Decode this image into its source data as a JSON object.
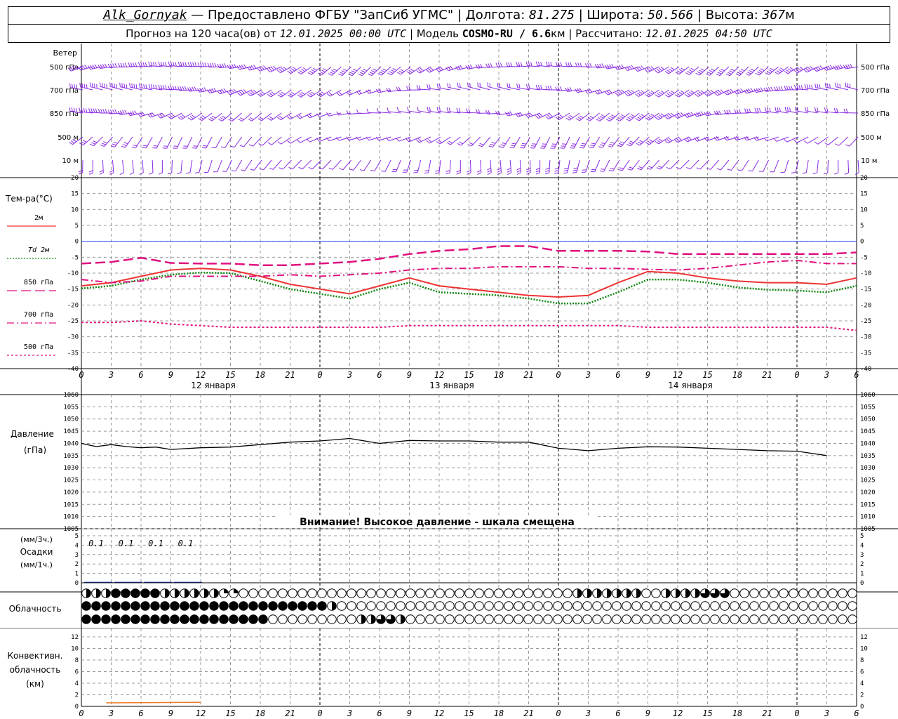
{
  "header": {
    "station": "Alk_Gornyak",
    "provider_text": " — Предоставлено ФГБУ \"ЗапСиб УГМС\" | Долгота: ",
    "longitude": "81.275",
    "lat_label": " | Широта: ",
    "latitude": "50.566",
    "alt_label": " | Высота: ",
    "altitude": "367",
    "alt_unit": "м",
    "forecast_label": "Прогноз на 120 часа(ов)  от ",
    "forecast_start": "12.01.2025 00:00 UTC",
    "model_label": "  | Модель ",
    "model_name": "COSMO-RU / 6.6",
    "model_unit": "км",
    "calc_label": " | Рассчитано: ",
    "calc_time": "12.01.2025 04:50 UTC"
  },
  "colors": {
    "wind": "#8a2be2",
    "t2m": "#ee3333",
    "td2m": "#118811",
    "t850": "#e0117f",
    "t700": "#e0117f",
    "t500": "#e0117f",
    "pressure": "#000000",
    "precip": "#1e3cc8",
    "convective": "#f07820",
    "zero_line": "#3050ff",
    "grid": "#999999"
  },
  "time_axis": {
    "tick_labels": [
      "0",
      "3",
      "6",
      "9",
      "12",
      "15",
      "18",
      "21",
      "0",
      "3",
      "6",
      "9",
      "12",
      "15",
      "18",
      "21",
      "0",
      "3",
      "6",
      "9",
      "12",
      "15",
      "18",
      "21",
      "0",
      "3",
      "6"
    ],
    "day_labels": [
      "12 января",
      "13 января",
      "14 января"
    ]
  },
  "wind_panel": {
    "title": "Ветер",
    "levels": [
      "500 гПа",
      "700 гПа",
      "850 гПа",
      "500 м",
      "10  м"
    ]
  },
  "temperature_panel": {
    "title": "Тем-ра(°С)",
    "legend": [
      {
        "label": "2м",
        "style": "solid"
      },
      {
        "label": "Td  2м",
        "style": "dotted"
      },
      {
        "label": "850 гПа",
        "style": "dash"
      },
      {
        "label": "700 гПа",
        "style": "dashdot"
      },
      {
        "label": "500 гПа",
        "style": "dot"
      }
    ],
    "ticks": [
      "20",
      "15",
      "10",
      "5",
      "0",
      "-5",
      "-10",
      "-15",
      "-20",
      "-25",
      "-30",
      "-35",
      "-40"
    ]
  },
  "pressure_panel": {
    "title_line1": "Давление",
    "title_line2": "(гПа)",
    "warning": "Внимание! Высокое давление - шкала смещена",
    "ticks": [
      "1060",
      "1055",
      "1050",
      "1045",
      "1040",
      "1035",
      "1030",
      "1025",
      "1020",
      "1015",
      "1010",
      "1005"
    ]
  },
  "precip_panel": {
    "label1": "(мм/3ч.)",
    "label2": "Осадки",
    "label3": "(мм/1ч.)",
    "ticks": [
      "5",
      "4",
      "3",
      "2",
      "1",
      "0"
    ],
    "amounts": [
      "0.1",
      "0.1",
      "0.1",
      "0.1"
    ]
  },
  "cloud_panel": {
    "title": "Облачность"
  },
  "convective_panel": {
    "title_line1": "Конвективн.",
    "title_line2": "облачность",
    "title_line3": "(км)",
    "ticks": [
      "12",
      "10",
      "8",
      "6",
      "4",
      "2",
      "0"
    ]
  },
  "chart_data": [
    {
      "type": "barbs",
      "title": "Ветер",
      "levels": [
        "500 гПа",
        "700 гПа",
        "850 гПа",
        "500 м",
        "10  м"
      ],
      "note": "wind barbs every hour at five levels"
    },
    {
      "type": "line",
      "title": "Тем-ра(°С)",
      "x": [
        0,
        3,
        6,
        9,
        12,
        15,
        18,
        21,
        24,
        27,
        30,
        33,
        36,
        39,
        42,
        45,
        48,
        51,
        54,
        57,
        60,
        63,
        66,
        69,
        72,
        75,
        78
      ],
      "ylim": [
        -40,
        20
      ],
      "series": [
        {
          "name": "2м",
          "values": [
            -14,
            -13,
            -11,
            -9,
            -8.5,
            -9,
            -11,
            -13.5,
            -15,
            -16.5,
            -14,
            -11.5,
            -14,
            -15,
            -16,
            -17,
            -17.5,
            -17,
            -13,
            -9.5,
            -10,
            -11.5,
            -12.5,
            -13,
            -13,
            -13.5,
            -11.5
          ]
        },
        {
          "name": "Td  2м",
          "values": [
            -14.8,
            -14,
            -12,
            -10.5,
            -9.8,
            -10,
            -12.5,
            -15,
            -16.5,
            -18,
            -15,
            -13,
            -16,
            -16.5,
            -17,
            -18,
            -19.5,
            -19.5,
            -16,
            -12,
            -12,
            -13,
            -14.5,
            -15.2,
            -15.5,
            -16,
            -14
          ]
        },
        {
          "name": "850 гПа",
          "values": [
            -7,
            -6.5,
            -5.2,
            -6.8,
            -7,
            -7,
            -7.5,
            -7.5,
            -7,
            -6.5,
            -5.5,
            -4,
            -3,
            -2.5,
            -1.5,
            -1.5,
            -3,
            -3,
            -3,
            -3.2,
            -4,
            -4,
            -4,
            -4,
            -4,
            -4,
            -3.5
          ]
        },
        {
          "name": "700 гПа",
          "values": [
            -12,
            -13,
            -12.5,
            -11,
            -11,
            -11,
            -11,
            -10.5,
            -11,
            -10.5,
            -10,
            -9,
            -8.5,
            -8.5,
            -8,
            -8,
            -8,
            -8.5,
            -8.5,
            -8.8,
            -9,
            -8.5,
            -7.5,
            -6.5,
            -6,
            -7,
            -7
          ]
        },
        {
          "name": "500 гПа",
          "values": [
            -25.5,
            -25.5,
            -25,
            -26,
            -26.5,
            -27,
            -27,
            -27,
            -27,
            -27,
            -27,
            -26.5,
            -26.5,
            -26.5,
            -26.5,
            -26.5,
            -26.5,
            -26.5,
            -26.5,
            -27,
            -27,
            -27,
            -27,
            -27,
            -27,
            -27,
            -28
          ]
        }
      ]
    },
    {
      "type": "line",
      "title": "Давление (гПа)",
      "x": [
        0,
        1.5,
        3,
        4.5,
        6,
        7.5,
        9,
        12,
        15,
        18,
        21,
        24,
        27,
        30,
        33,
        36,
        39,
        42,
        45,
        48,
        51,
        54,
        57,
        60,
        63,
        66,
        69,
        72,
        75,
        78
      ],
      "ylim": [
        1005,
        1060
      ],
      "series": [
        {
          "name": "Давление",
          "values": [
            1040,
            1038.7,
            1039.5,
            1038.7,
            1038.2,
            1038.5,
            1037.5,
            1038.2,
            1038.5,
            1039.5,
            1040.5,
            1041,
            1042,
            1040,
            1041.2,
            1041,
            1041,
            1040.5,
            1040.5,
            1038,
            1037,
            1038,
            1038.6,
            1038.5,
            1038,
            1037.5,
            1037,
            1036.8,
            1035
          ]
        }
      ]
    },
    {
      "type": "bar",
      "title": "Осадки",
      "x": [
        0,
        3,
        6,
        9
      ],
      "values": [
        0.1,
        0.1,
        0.1,
        0.1
      ],
      "ylim": [
        0,
        5
      ]
    },
    {
      "type": "table",
      "title": "Облачность",
      "rows": [
        "upper",
        "middle",
        "lower"
      ],
      "values_per_hour": {
        "upper": [
          0.5,
          0.5,
          0.5,
          1,
          1,
          1,
          1,
          1,
          0.5,
          0.5,
          0.5,
          0.5,
          0.5,
          0.5,
          0.25,
          0.25,
          0,
          0,
          0,
          0,
          0,
          0,
          0,
          0,
          0,
          0,
          0,
          0,
          0,
          0,
          0,
          0,
          0,
          0,
          0,
          0,
          0,
          0,
          0,
          0,
          0,
          0,
          0,
          0,
          0,
          0,
          0,
          0,
          0,
          0,
          0.5,
          0.5,
          0.5,
          0.5,
          0.5,
          0.5,
          0.5,
          0,
          0,
          0.5,
          0.5,
          0.5,
          0.5,
          0.75,
          0.75,
          0.75,
          0,
          0,
          0,
          0,
          0,
          0,
          0,
          0,
          0,
          0,
          0,
          0,
          0
        ],
        "middle": [
          1,
          1,
          1,
          1,
          1,
          1,
          1,
          1,
          1,
          1,
          1,
          1,
          1,
          1,
          1,
          1,
          1,
          1,
          1,
          1,
          1,
          1,
          1,
          1,
          1,
          0.5,
          0,
          0,
          0,
          0,
          0,
          0,
          0,
          0,
          0,
          0,
          0,
          0,
          0,
          0,
          0,
          0,
          0,
          0,
          0,
          0,
          0,
          0,
          0,
          0,
          0,
          0,
          0,
          0,
          0,
          0,
          0,
          0,
          0,
          0,
          0,
          0,
          0,
          0,
          0,
          0,
          0,
          0,
          0,
          0,
          0,
          0,
          0,
          0,
          0,
          0,
          0,
          0,
          0
        ],
        "lower": [
          1,
          1,
          1,
          1,
          1,
          1,
          1,
          1,
          1,
          1,
          1,
          1,
          1,
          1,
          1,
          1,
          1,
          1,
          1,
          0,
          0,
          0,
          0,
          0,
          0,
          0,
          0,
          0,
          0.5,
          0.5,
          0.75,
          0.75,
          0.5,
          0,
          0,
          0,
          0,
          0,
          0,
          0,
          0,
          0,
          0,
          0,
          0,
          0,
          0,
          0,
          0,
          0,
          0,
          0,
          0,
          0,
          0,
          0,
          0,
          0,
          0,
          0,
          0,
          0,
          0,
          0,
          0,
          0,
          0,
          0,
          0,
          0,
          0,
          0,
          0,
          0,
          0,
          0,
          0,
          0,
          0
        ]
      }
    },
    {
      "type": "line",
      "title": "Конвективн. облачность (км)",
      "x": [
        2.5,
        12
      ],
      "ylim": [
        0,
        12
      ],
      "series": [
        {
          "name": "Конвективн. облачность",
          "values": [
            0.6,
            0.7
          ]
        }
      ]
    }
  ]
}
